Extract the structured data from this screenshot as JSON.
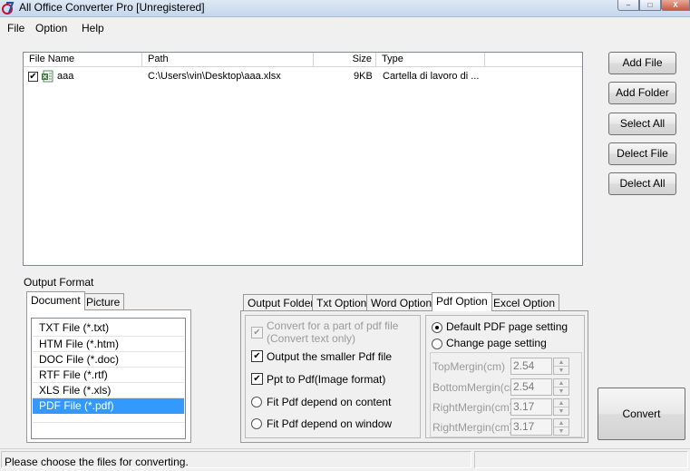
{
  "window": {
    "title": "All Office Converter Pro [Unregistered]",
    "min_glyph": "–",
    "max_glyph": "□",
    "close_glyph": "X"
  },
  "menu": [
    "File",
    "Option",
    "Help"
  ],
  "file_list": {
    "columns": [
      "File Name",
      "Path",
      "Size",
      "Type"
    ],
    "rows": [
      {
        "checked": "✔",
        "name": "aaa",
        "path": "C:\\Users\\vin\\Desktop\\aaa.xlsx",
        "size": "9KB",
        "type": "Cartella di lavoro di ..."
      }
    ]
  },
  "side_buttons": [
    "Add File",
    "Add Folder",
    "Select All",
    "Delect File",
    "Delect All"
  ],
  "output_format": {
    "label": "Output Format",
    "tabs": [
      "Document",
      "Picture"
    ],
    "items": [
      "TXT File  (*.txt)",
      "HTM File  (*.htm)",
      "DOC File  (*.doc)",
      "RTF File  (*.rtf)",
      "XLS File  (*.xls)",
      "PDF File  (*.pdf)"
    ],
    "selected_index": 5
  },
  "option_tabs": [
    "Output Folder",
    "Txt Option",
    "Word Option",
    "Pdf Option",
    "Excel Option"
  ],
  "pdf_option": {
    "check_glyph": "✔",
    "part_convert_line1": "Convert for a part of pdf file",
    "part_convert_line2": "(Convert text only)",
    "smaller_pdf": "Output the smaller Pdf file",
    "ppt_to_pdf": "Ppt to Pdf(Image format)",
    "fit_content": "Fit Pdf depend on content",
    "fit_window": "Fit Pdf depend on window",
    "default_page": "Default PDF page setting",
    "change_page": "Change page setting",
    "margins": [
      {
        "label": "TopMergin(cm)",
        "value": "2.54"
      },
      {
        "label": "BottomMergin(cm)",
        "value": "2.54"
      },
      {
        "label": "RightMergin(cm)",
        "value": "3.17"
      },
      {
        "label": "RightMergin(cm)",
        "value": "3.17"
      }
    ]
  },
  "convert_label": "Convert",
  "status": "Please choose the files for converting."
}
